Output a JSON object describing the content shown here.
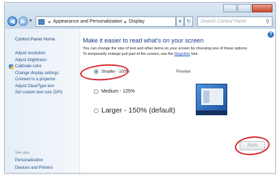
{
  "window": {
    "controls": [
      "minimize",
      "maximize",
      "close"
    ]
  },
  "navigation": {
    "back_icon": "back-arrow-icon",
    "forward_icon": "forward-arrow-icon",
    "breadcrumb": [
      "Appearance and Personalization",
      "Display"
    ],
    "search_placeholder": "Search Control Panel"
  },
  "sidebar": {
    "home": "Control Panel Home",
    "items": [
      {
        "label": "Adjust resolution"
      },
      {
        "label": "Adjust brightness"
      },
      {
        "label": "Calibrate color",
        "icon": "shield-icon"
      },
      {
        "label": "Change display settings"
      },
      {
        "label": "Connect to a projector"
      },
      {
        "label": "Adjust ClearType text"
      },
      {
        "label": "Set custom text size (DPI)"
      }
    ],
    "see_also_title": "See also",
    "see_also": [
      "Personalization",
      "Devices and Printers"
    ]
  },
  "main": {
    "heading": "Make it easier to read what's on your screen",
    "description_line1": "You can change the size of text and other items on your screen by choosing one of these options.",
    "description_line2": "To temporarily enlarge just part of the screen, use the",
    "magnifier_link": "Magnifier",
    "description_end": "tool.",
    "options": [
      {
        "label": "Smaller - 100%",
        "selected": true
      },
      {
        "label": "Medium - 125%",
        "selected": false
      },
      {
        "label": "Larger - 150% (default)",
        "selected": false
      }
    ],
    "preview_label": "Preview",
    "apply_label": "Apply",
    "apply_enabled": false
  },
  "colors": {
    "annotation": "#d8262c",
    "link": "#1d4f8c",
    "heading": "#1a3e8c"
  }
}
